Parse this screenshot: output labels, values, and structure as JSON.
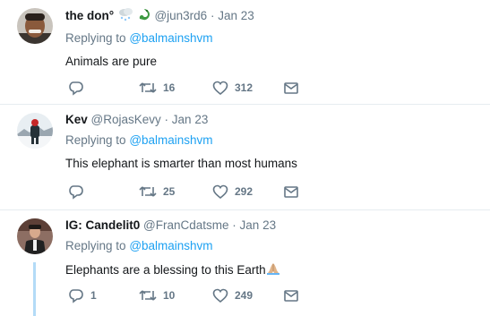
{
  "tweets": [
    {
      "name": "the don°",
      "handle": "@jun3rd6",
      "date": "Jan 23",
      "replying_to": "Replying to",
      "mention": "@balmainshvm",
      "text": "Animals are pure",
      "replies": "",
      "retweets": "16",
      "likes": "312"
    },
    {
      "name": "Kev",
      "handle": "@RojasKevy",
      "date": "Jan 23",
      "replying_to": "Replying to",
      "mention": "@balmainshvm",
      "text": "This elephant is smarter than most humans",
      "replies": "",
      "retweets": "25",
      "likes": "292"
    },
    {
      "name": "IG: Candelit0",
      "handle": "@FranCdatsme",
      "date": "Jan 23",
      "replying_to": "Replying to",
      "mention": "@balmainshvm",
      "text": "Elephants are a blessing to this Earth",
      "replies": "1",
      "retweets": "10",
      "likes": "249"
    }
  ],
  "separator": "·",
  "icons": {
    "reply": "reply-icon",
    "retweet": "retweet-icon",
    "like": "heart-icon",
    "dm": "direct-message-icon",
    "emoji_1": "snow-cloud-emoji",
    "emoji_2": "dragon-emoji",
    "emoji_3": "praying-hands-emoji"
  },
  "colors": {
    "link": "#1da1f2",
    "muted": "#657786",
    "thread_line": "#b3dbf7"
  }
}
